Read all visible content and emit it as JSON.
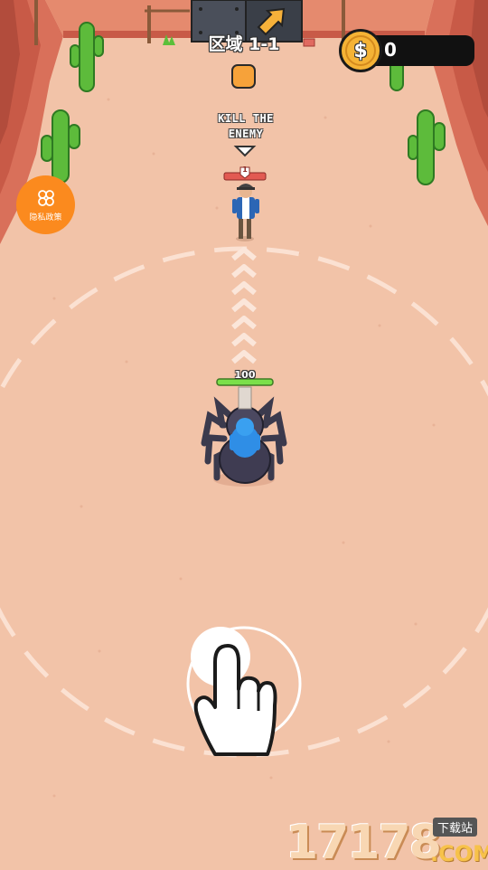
{
  "hud": {
    "level_label": "区域 1-1",
    "coins": "0",
    "coin_symbol": "$"
  },
  "privacy_button": {
    "label": "隐私政策"
  },
  "objective": {
    "line1": "KILL THE",
    "line2": "ENEMY"
  },
  "enemy": {
    "health_value": "1"
  },
  "player": {
    "health_value": "100"
  },
  "watermark": {
    "number": "17178",
    "tag": "下载站",
    "domain": ".COM"
  },
  "colors": {
    "sand": "#f2c3a8",
    "canyon": "#d9705a",
    "player_health": "#7be04a",
    "enemy_health": "#e25a52",
    "privacy_button": "#fb8a1e",
    "coin": "#f5b335"
  }
}
